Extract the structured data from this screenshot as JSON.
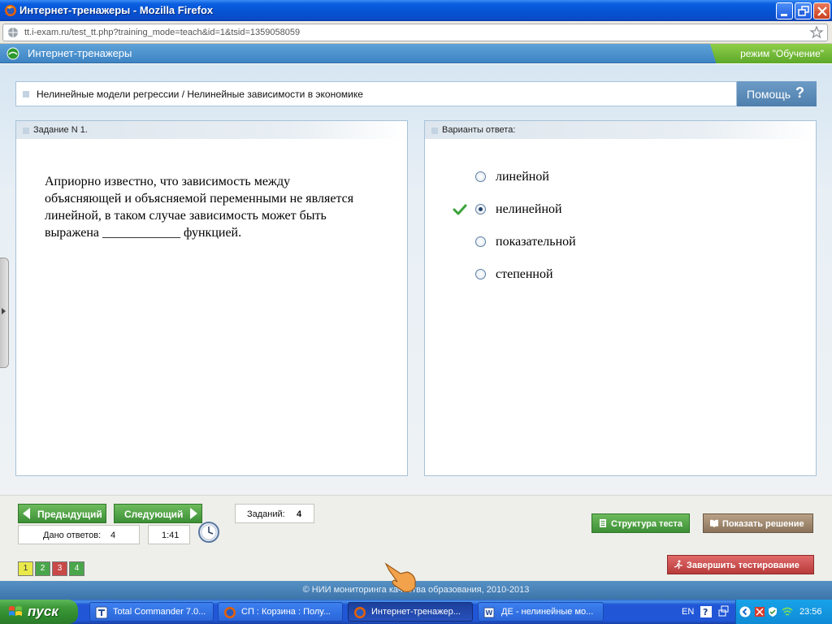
{
  "window": {
    "title": "Интернет-тренажеры - Mozilla Firefox",
    "url": "tt.i-exam.ru/test_tt.php?training_mode=teach&id=1&tsid=1359058059"
  },
  "app": {
    "title": "Интернет-тренажеры",
    "mode": "режим \"Обучение\""
  },
  "breadcrumb": "Нелинейные модели регрессии / Нелинейные зависимости в экономике",
  "help_label": "Помощь",
  "help_symbol": "?",
  "task_panel": {
    "title": "Задание N 1.",
    "question": "Априорно известно, что зависимость между объясняющей и объясняемой переменными не является линейной, в таком случае зависимость может быть выражена ____________ функцией."
  },
  "answer_panel": {
    "title": "Варианты ответа:",
    "options": [
      {
        "label": "линейной",
        "selected": false,
        "correct": false
      },
      {
        "label": "нелинейной",
        "selected": true,
        "correct": true
      },
      {
        "label": "показательной",
        "selected": false,
        "correct": false
      },
      {
        "label": "степенной",
        "selected": false,
        "correct": false
      }
    ]
  },
  "nav": {
    "prev_label": "Предыдущий",
    "next_label": "Следующий",
    "tasks_label": "Заданий:",
    "tasks_count": "4",
    "answers_label": "Дано ответов:",
    "answers_count": "4",
    "timer": "1:41",
    "structure_label": "Структура теста",
    "solution_label": "Показать решение",
    "finish_label": "Завершить тестирование",
    "task_numbers": [
      {
        "num": "1",
        "color": "#e9e94a",
        "text_color": "#333333"
      },
      {
        "num": "2",
        "color": "#4aa64a",
        "text_color": "#ffffff"
      },
      {
        "num": "3",
        "color": "#c94848",
        "text_color": "#ffffff"
      },
      {
        "num": "4",
        "color": "#4aa64a",
        "text_color": "#ffffff"
      }
    ]
  },
  "footer": "© НИИ мониторинга качества образования, 2010-2013",
  "taskbar": {
    "start_label": "пуск",
    "tasks": [
      {
        "label": "Total Commander 7.0...",
        "icon": "total-commander-icon",
        "active": false
      },
      {
        "label": "СП : Корзина : Полу...",
        "icon": "firefox-icon",
        "active": false
      },
      {
        "label": "Интернет-тренажер...",
        "icon": "firefox-icon",
        "active": true
      },
      {
        "label": "ДЕ - нелинейные мо...",
        "icon": "word-icon",
        "active": false
      }
    ],
    "lang": "EN",
    "time": "23:56"
  },
  "colors": {
    "accent_blue": "#3e84c4",
    "mode_green": "#5da82a",
    "correct_check": "#3aa33a"
  }
}
